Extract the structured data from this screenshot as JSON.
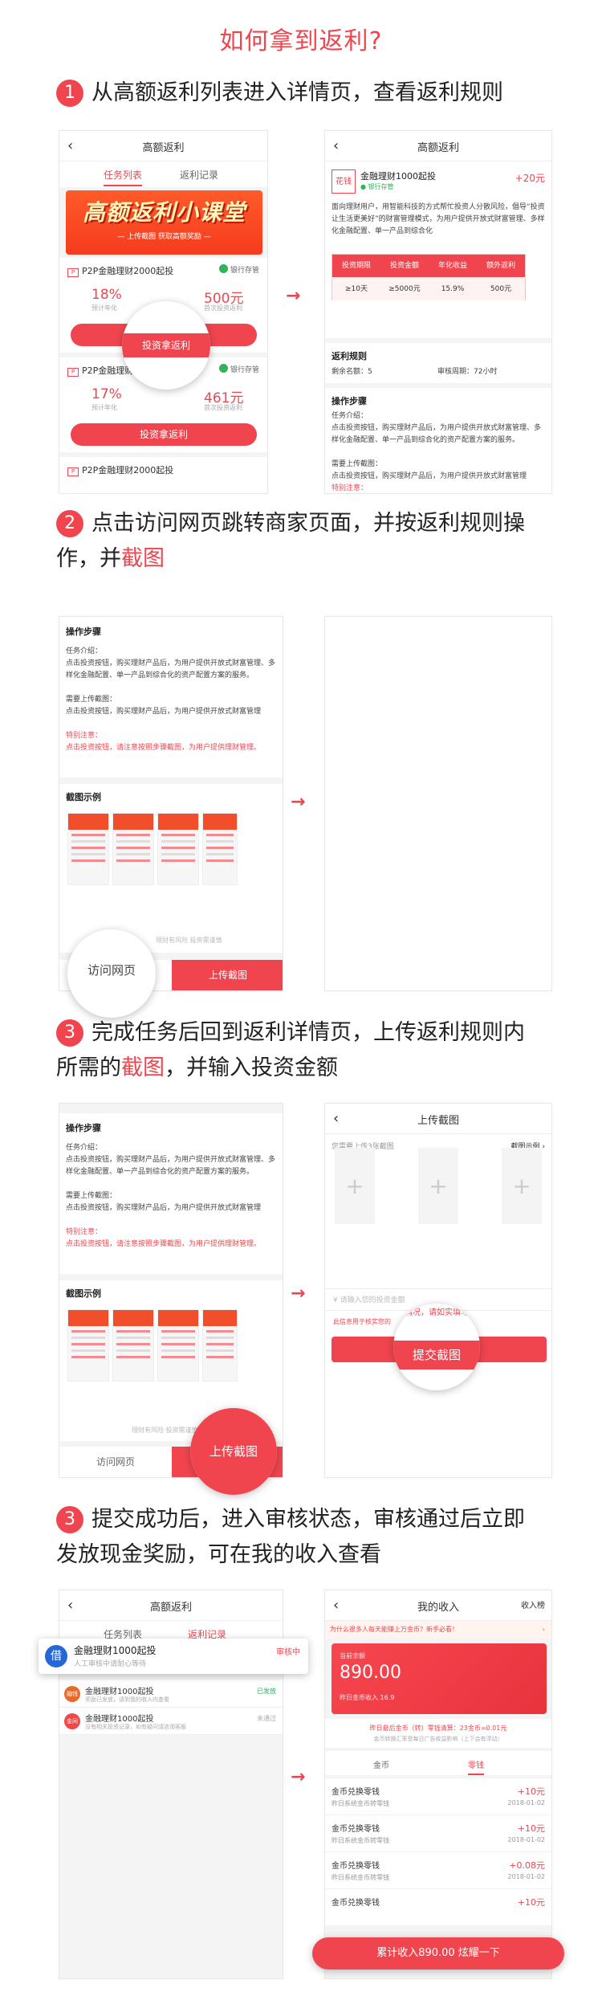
{
  "title": "如何拿到返利?",
  "steps": [
    {
      "num": "1",
      "text": "从高额返利列表进入详情页，查看返利规则"
    },
    {
      "num": "2",
      "text_a": "点击访问网页跳转商家页面，并按返利规则操",
      "text_b": "作，并",
      "hl": "截图"
    },
    {
      "num": "3",
      "text_a": "完成任务后回到返利详情页，上传返利规则内",
      "text_b": "所需的",
      "hl": "截图",
      "text_c": "，并输入投资金额"
    },
    {
      "num": "3",
      "text_a": "提交成功后，进入审核状态，审核通过后立即",
      "text_b": "发放现金奖励，可在我的收入查看"
    }
  ],
  "common": {
    "rebate_title": "高额返利",
    "tab_tasks": "任务列表",
    "tab_records": "返利记录",
    "banner_main": "高额返利小课堂",
    "banner_sub": "— 上传截图 获取高额奖励 —",
    "product": "P2P金融理财2000起投",
    "product_short": "P2P金融理财1000",
    "product_1000": "金融理财1000起投",
    "bank": "银行存管",
    "invest_btn": "投资拿返利",
    "rate1": "18%",
    "amount1": "500元",
    "rate2": "17%",
    "amount2": "461元",
    "label_rate": "预计年化",
    "label_first": "首次投资返利",
    "ops_title": "操作步骤",
    "task_intro": "任务介绍：",
    "task_text": "点击投资按钮，购买理财产品后，为用户提供开放式财富管理、多样化金融配置、单一产品到综合化的资产配置方案的服务。",
    "need_upload": "需要上传截图：",
    "need_text": "点击投资按钮，购买理财产品后，为用户提供开放式财富管理",
    "special": "特别注意：",
    "special_text": "点击投资按钮，请注意按照步骤截图，为用户提供理财管理。",
    "screenshot_example": "截图示例",
    "visit": "访问网页",
    "upload_shot": "上传截图",
    "risk_note": "理财有风险 投资需谨慎"
  },
  "detail": {
    "logo": "花钱",
    "name": "金融理财1000起投",
    "bank": "银行存管",
    "reward": "+20元",
    "desc": "面向理财用户，用智能科技的方式帮忙投资人分散风险，倡导“投资让生活更美好”的财富管理模式，为用户提供开放式财富管理、多样化金融配置、单一产品到综合化",
    "headers": [
      "投资期限",
      "投资金额",
      "年化收益",
      "额外返利"
    ],
    "cells": [
      "≥10天",
      "≥5000元",
      "15.9%",
      "500元"
    ],
    "rules_title": "返利规则",
    "remaining": "剩余名额：5",
    "cycle": "审核周期：72小时"
  },
  "upload": {
    "title": "上传截图",
    "hint": "您需要上传3张截图",
    "example": "截图示例",
    "amount_placeholder": "请输入您的投资金额",
    "warn": "此信息用于核实您的",
    "warn2": "情况，请如实填写",
    "submit": "提交截图",
    "plus": "+"
  },
  "review": {
    "item1_name": "金融理财1000起投",
    "item1_sub": "人工审核中请耐心等待",
    "item1_status": "审核中",
    "item2_name": "金融理财1000起投",
    "item2_sub": "奖励已发放，请到我的收入内查看",
    "item2_status": "已发放",
    "item3_name": "金融理财1000起投",
    "item3_sub": "没有相关投资记录，如有疑问请咨询客服",
    "item3_status": "未通过",
    "icon1": "借",
    "icon2": "融钱",
    "icon3": "金间"
  },
  "income": {
    "title": "我的收入",
    "rank": "收入榜",
    "promo": "为什么很多人每天能赚上万金币？新手必看！",
    "balance_label": "当前余额",
    "balance": "890.00",
    "yesterday": "昨日金币收入 16.9",
    "rate_line": "昨日最后金币（转）零钱清算：23金币=0.01元",
    "rate_sub": "金币转换汇率受每日广告收益影响（上下会有浮动）",
    "tab_coin": "金币",
    "tab_cash": "零钱",
    "rows": [
      {
        "t1": "金币兑换零钱",
        "t2": "昨日系统金币转零钱",
        "a": "+10元",
        "d": "2018-01-02"
      },
      {
        "t1": "金币兑换零钱",
        "t2": "昨日系统金币转零钱",
        "a": "+10元",
        "d": "2018-01-02"
      },
      {
        "t1": "金币兑换零钱",
        "t2": "昨日系统金币转零钱",
        "a": "+0.08元",
        "d": "2018-01-02"
      },
      {
        "t1": "金币兑换零钱",
        "t2": "",
        "a": "+10元",
        "d": ""
      }
    ],
    "total_btn": "累计收入890.00 炫耀一下"
  },
  "colors": {
    "accent": "#f0454f",
    "green": "#2fb45a"
  }
}
